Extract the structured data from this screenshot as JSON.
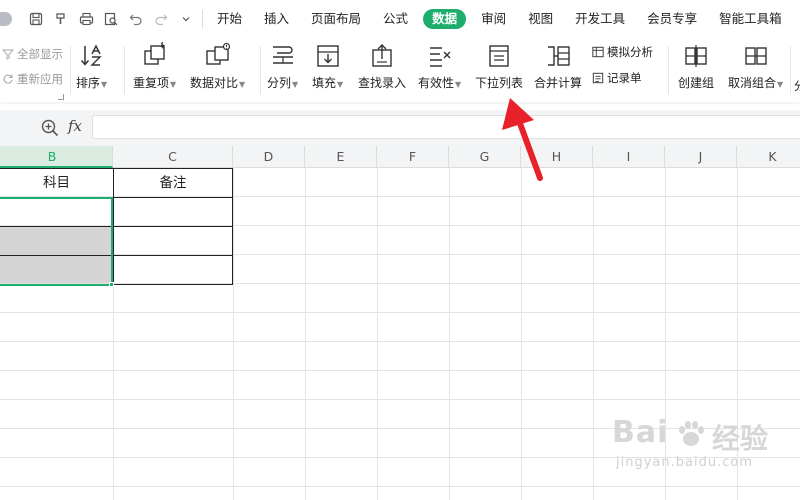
{
  "menubar": {
    "tabs": [
      "开始",
      "插入",
      "页面布局",
      "公式",
      "数据",
      "审阅",
      "视图",
      "开发工具",
      "会员专享",
      "智能工具箱"
    ],
    "active_tab": "数据"
  },
  "ribbon": {
    "show_all": "全部显示",
    "reapply": "重新应用",
    "sort": "排序",
    "duplicates": "重复项",
    "compare": "数据对比",
    "split": "分列",
    "fill": "填充",
    "lookup_entry": "查找录入",
    "validity": "有效性",
    "dropdown_list": "下拉列表",
    "merge_calc": "合并计算",
    "simulate": "模拟分析",
    "record_form": "记录单",
    "create_group": "创建组",
    "ungroup": "取消组合",
    "trailing": "分"
  },
  "formula_bar": {
    "fx": "fx",
    "value": ""
  },
  "sheet": {
    "columns": [
      "B",
      "C",
      "D",
      "E",
      "F",
      "G",
      "H",
      "I",
      "J",
      "K"
    ],
    "selected_column": "B",
    "headers": {
      "b1": "科目",
      "c1": "备注"
    }
  },
  "watermark": {
    "logo": "Bai",
    "logo2": "经验",
    "url": "jingyan.baidu.com"
  },
  "colors": {
    "accent": "#1fad6e",
    "arrow": "#e8202a",
    "selection_fill": "#d4d4d4"
  }
}
